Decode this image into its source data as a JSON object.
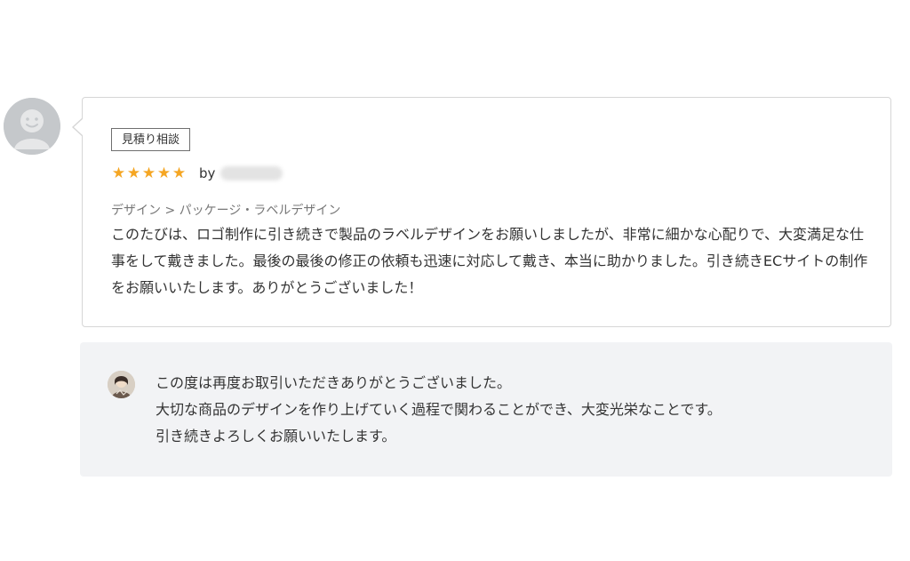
{
  "review": {
    "tag": "見積り相談",
    "rating": 5,
    "stars": [
      "★",
      "★",
      "★",
      "★",
      "★"
    ],
    "by_label": "by",
    "category": "デザイン > パッケージ・ラベルデザイン",
    "text": "このたびは、ロゴ制作に引き続きで製品のラベルデザインをお願いしましたが、非常に細かな心配りで、大変満足な仕事をして戴きました。最後の最後の修正の依頼も迅速に対応して戴き、本当に助かりました。引き続きECサイトの制作をお願いいたします。ありがとうございました！"
  },
  "reply": {
    "lines": [
      "この度は再度お取引いただきありがとうございました。",
      "大切な商品のデザインを作り上げていく過程で関わることができ、大変光栄なことです。",
      "引き続きよろしくお願いいたします。"
    ]
  },
  "colors": {
    "star": "#f5a623",
    "card_border": "#d6d6d6",
    "reply_background": "#f2f3f5",
    "category_text": "#777777"
  },
  "icons": {
    "reviewer_avatar": "default-user-icon",
    "seller_avatar": "seller-avatar"
  }
}
